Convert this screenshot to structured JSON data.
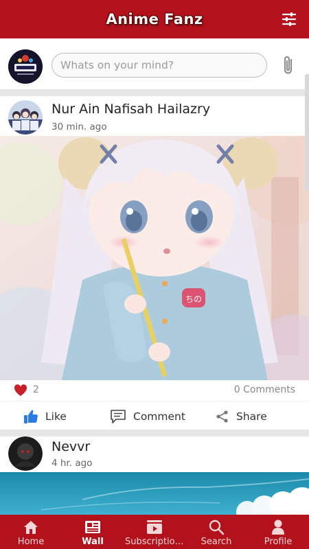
{
  "header": {
    "title": "Anime Fanz",
    "filter_icon": "tune-sliders-icon"
  },
  "composer": {
    "placeholder": "Whats on your mind?",
    "attach_icon": "paperclip-icon"
  },
  "posts": [
    {
      "author": "Nur Ain Nafisah Hailazry",
      "time": "30 min. ago",
      "likes": "2",
      "comments": "0 Comments",
      "actions": {
        "like": "Like",
        "comment": "Comment",
        "share": "Share"
      }
    },
    {
      "author": "Nevvr",
      "time": "4 hr. ago"
    }
  ],
  "nav": {
    "items": [
      {
        "label": "Home",
        "icon": "home-icon",
        "active": false
      },
      {
        "label": "Wall",
        "icon": "newspaper-icon",
        "active": true
      },
      {
        "label": "Subscriptions",
        "icon": "video-play-icon",
        "active": false
      },
      {
        "label": "Search",
        "icon": "search-icon",
        "active": false
      },
      {
        "label": "Profile",
        "icon": "person-icon",
        "active": false
      }
    ]
  },
  "colors": {
    "brand": "#b3121d",
    "like_red": "#c8202a",
    "like_blue": "#2b7be4",
    "text": "#222222",
    "muted": "#888888"
  }
}
